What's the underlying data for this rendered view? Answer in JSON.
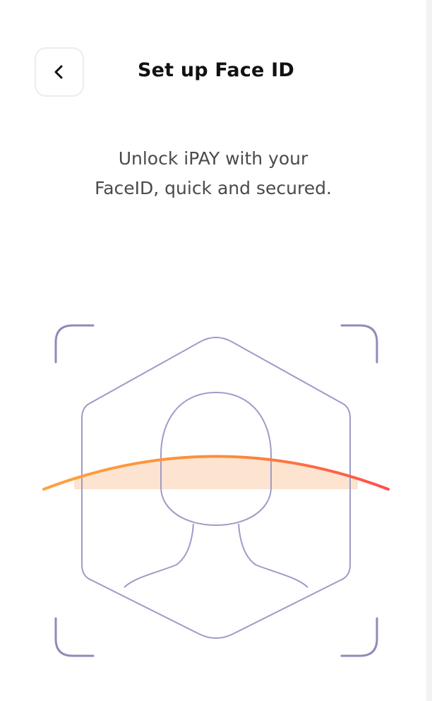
{
  "header": {
    "title": "Set up Face ID",
    "back_icon": "chevron-left-icon"
  },
  "content": {
    "subtitle_line1": "Unlock iPAY with your",
    "subtitle_line2": "FaceID, quick and secured."
  },
  "illustration": {
    "icon": "face-scan-icon",
    "frame_color": "#8f8bb8",
    "outline_color": "#9f9bc8",
    "scan_gradient_start": "#ffa23d",
    "scan_gradient_end": "#ff4d4d",
    "scan_fill_color": "#fde3cf"
  },
  "colors": {
    "background": "#ffffff",
    "title": "#111111",
    "subtitle": "#4a4a4a",
    "button_border": "#ececec"
  }
}
